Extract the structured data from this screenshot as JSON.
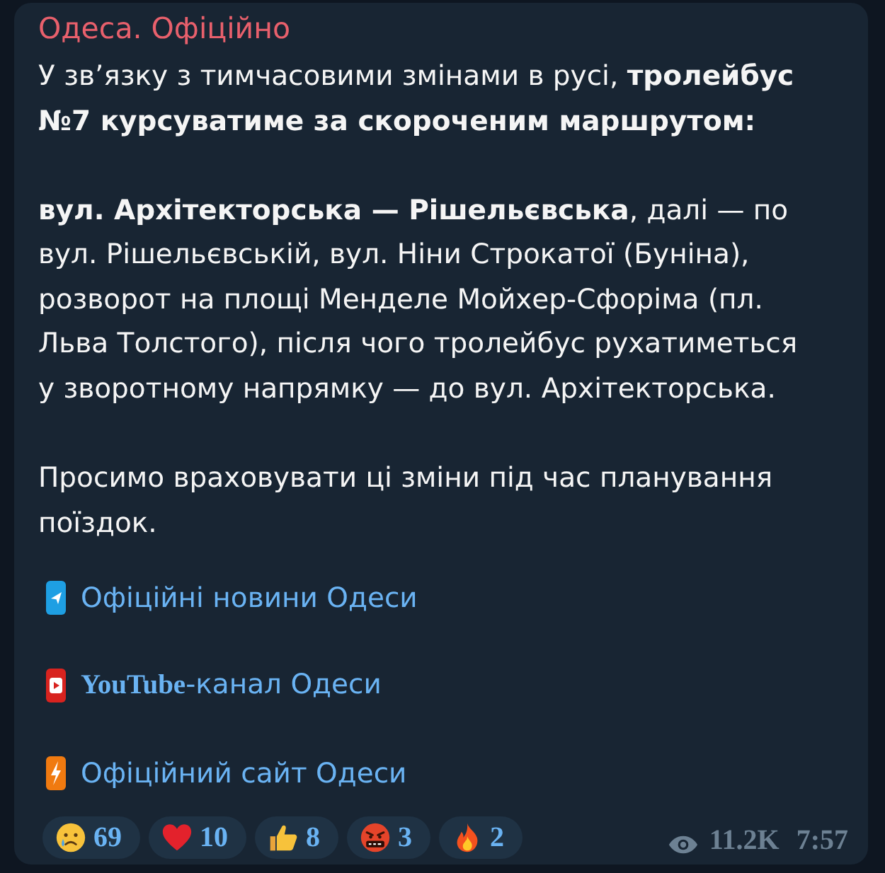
{
  "message": {
    "channel": "Одеса. Офіційно",
    "paragraphs": [
      "У зв’язку з тимчасовими змінами в русі, **тролейбус №7 курсуватиме за скороченим маршрутом:**",
      "**вул. Архітекторська — Рішельєвська**, далі — по вул. Рішельєвській, вул. Ніни Строкатої (Буніна), розворот на площі Менделе Мойхер-Сфоріма (пл. Льва Толстого), після чого тролейбус рухатиметься у зворотному напрямку — до вул. Архітекторська.",
      "Просимо враховувати ці зміни під час планування поїздок."
    ],
    "links": [
      {
        "kind": "telegram",
        "text": "Офіційні новини Одеси"
      },
      {
        "kind": "youtube",
        "text": "**YouTube**-канал Одеси"
      },
      {
        "kind": "website",
        "text": "Офіційний сайт Одеси"
      }
    ],
    "reactions": [
      {
        "kind": "crying",
        "count": "69",
        "selected": false
      },
      {
        "kind": "heart",
        "count": "10",
        "selected": false
      },
      {
        "kind": "thumbs_up",
        "count": "8",
        "selected": false
      },
      {
        "kind": "cursing",
        "count": "3",
        "selected": false
      },
      {
        "kind": "fire",
        "count": "2",
        "selected": false
      }
    ],
    "views": "11.2K",
    "time": "7:57"
  }
}
